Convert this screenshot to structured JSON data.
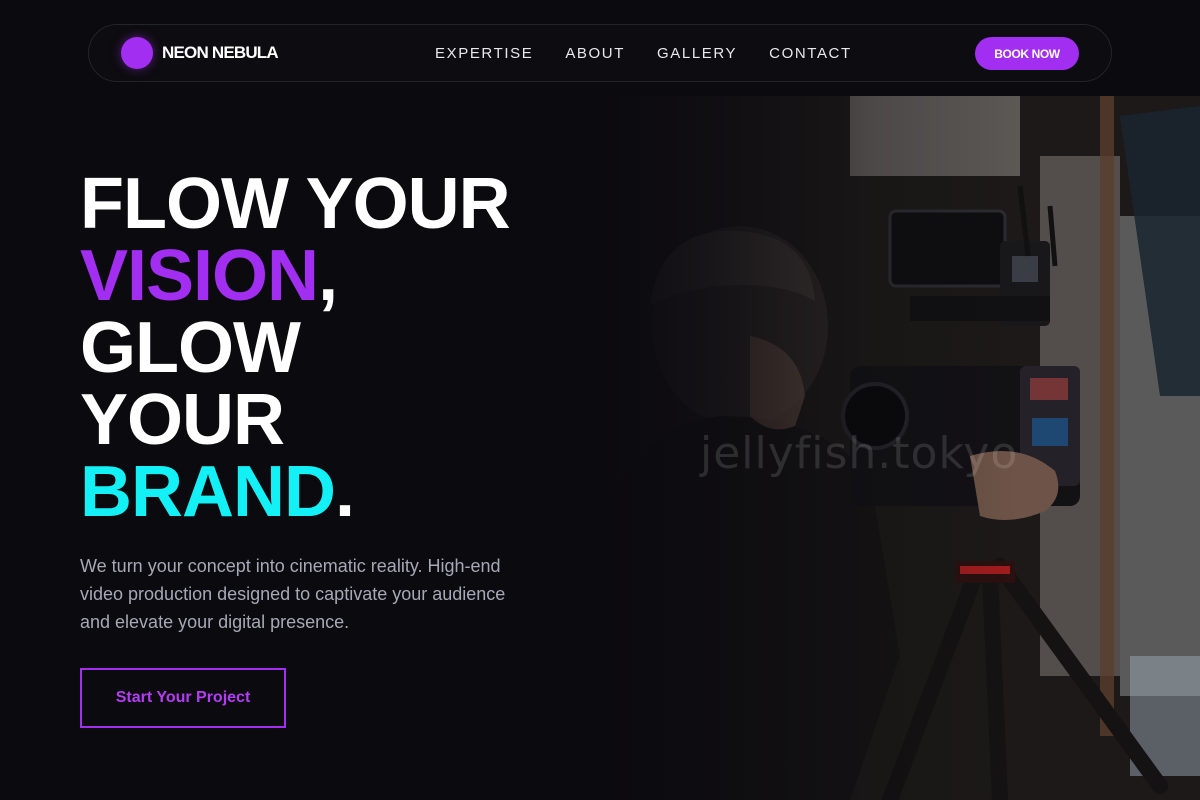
{
  "brand": {
    "name": "NEON NEBULA",
    "accent": "#a12ef0"
  },
  "nav": {
    "items": [
      {
        "label": "EXPERTISE"
      },
      {
        "label": "ABOUT"
      },
      {
        "label": "GALLERY"
      },
      {
        "label": "CONTACT"
      }
    ],
    "cta_label": "BOOK NOW"
  },
  "hero": {
    "headline": {
      "line1": "FLOW YOUR",
      "line2_highlight": "VISION",
      "line2_rest": ",",
      "line3": "GLOW",
      "line4": "YOUR",
      "line5_highlight": "BRAND",
      "line5_rest": "."
    },
    "highlight_colors": {
      "vision": "#a12ef0",
      "brand": "#14f1f6"
    },
    "description": "We turn your concept into cinematic reality. High-end video production designed to captivate your audience and elevate your digital presence.",
    "cta_label": "Start Your Project",
    "image": {
      "icon": "cinematographer-camera-photo",
      "watermark": "jellyfish.tokyo"
    }
  },
  "colors": {
    "background": "#0b0a0f",
    "text": "#ffffff",
    "muted_text": "#a7a8b6"
  }
}
